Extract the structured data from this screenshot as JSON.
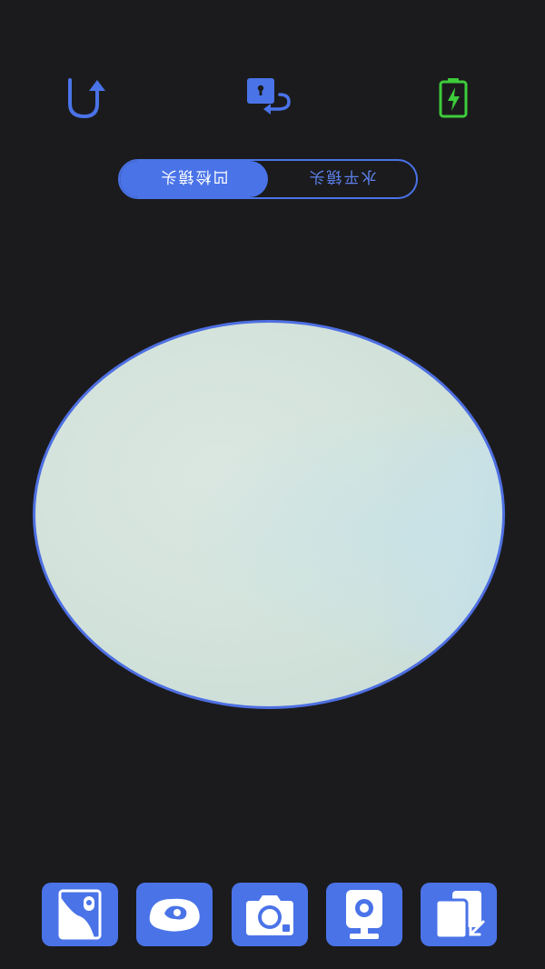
{
  "top_bar": {
    "rotate_icon": "rotate-back-arrow-icon",
    "unlock_icon": "unlock-rotate-icon",
    "battery_icon": "battery-charging-icon"
  },
  "lens_switch": {
    "active_label": "凹检镜头",
    "inactive_label": "水平镜头"
  },
  "toolbar": {
    "icons": [
      "gallery-photo-icon",
      "ear-icon",
      "camera-capture-icon",
      "webcam-icon",
      "switch-screen-icon"
    ]
  },
  "colors": {
    "background": "#1b1b1d",
    "accent": "#4a73e8",
    "battery": "#3dcc3a",
    "viewfinder_border": "#4e6fe2"
  }
}
